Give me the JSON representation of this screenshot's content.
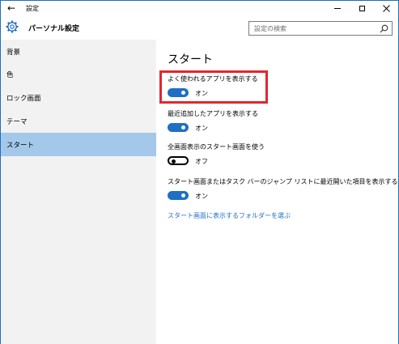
{
  "window": {
    "title": "設定",
    "back_glyph": "←"
  },
  "header": {
    "title": "パーソナル設定",
    "search_placeholder": "設定の検索"
  },
  "nav": {
    "items": [
      {
        "label": "背景"
      },
      {
        "label": "色"
      },
      {
        "label": "ロック画面"
      },
      {
        "label": "テーマ"
      },
      {
        "label": "スタート"
      }
    ],
    "selected": "スタート"
  },
  "content": {
    "title": "スタート",
    "settings": [
      {
        "label": "よく使われるアプリを表示する",
        "state": "オン",
        "on": true
      },
      {
        "label": "最近追加したアプリを表示する",
        "state": "オン",
        "on": true
      },
      {
        "label": "全画面表示のスタート画面を使う",
        "state": "オフ",
        "on": false
      },
      {
        "label": "スタート画面またはタスク バーのジャンプ リストに最近開いた項目を表示する",
        "state": "オン",
        "on": true
      }
    ],
    "link": "スタート画面に表示するフォルダーを選ぶ"
  },
  "colors": {
    "accent": "#1f6fc5",
    "nav_selected": "#a3c8ea",
    "highlight": "#e2262f"
  }
}
